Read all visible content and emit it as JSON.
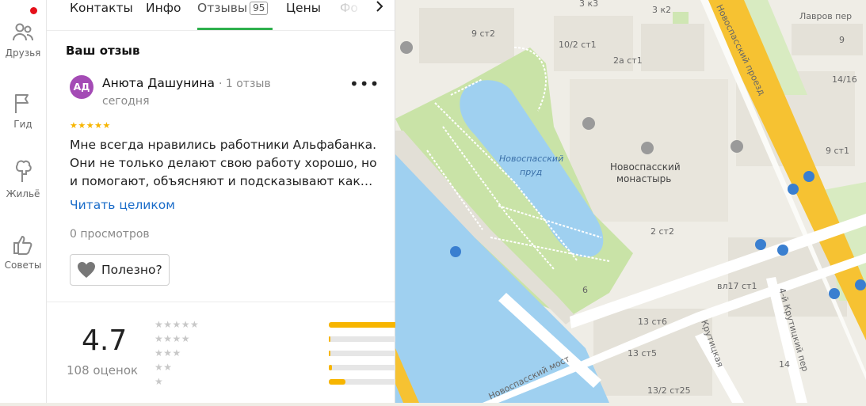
{
  "rail": {
    "items": [
      {
        "label": "Друзья",
        "icon": "friends-icon"
      },
      {
        "label": "Гид",
        "icon": "flag-icon"
      },
      {
        "label": "Жильё",
        "icon": "lodging-icon"
      },
      {
        "label": "Советы",
        "icon": "thumbs-up-icon"
      }
    ]
  },
  "tabs": {
    "contacts": "Контакты",
    "info": "Инфо",
    "reviews": "Отзывы",
    "reviews_count": "95",
    "prices": "Цены",
    "photos": "Фо"
  },
  "review": {
    "section_title": "Ваш отзыв",
    "avatar_initials": "АД",
    "author": "Анюта Дашунина",
    "author_meta": "· 1 отзыв",
    "date": "сегодня",
    "stars": "★★★★★",
    "rating": 5,
    "text_lines": [
      "Мне всегда нравились работники Альфабанка.",
      "Они не только делают свою работу хорошо, но",
      "и помогают, объясняют и подсказывают как…"
    ],
    "read_more": "Читать целиком",
    "views": "0 просмотров",
    "useful": "Полезно?"
  },
  "summary": {
    "rating": "4.7",
    "count": "108 оценок",
    "distribution": [
      {
        "stars": "★★★★★",
        "fraction": 1.0
      },
      {
        "stars": "★★★★",
        "fraction": 0.01
      },
      {
        "stars": "★★★",
        "fraction": 0.01
      },
      {
        "stars": "★★",
        "fraction": 0.02
      },
      {
        "stars": "★",
        "fraction": 0.11
      }
    ]
  },
  "map": {
    "labels": [
      {
        "text": "3 к3"
      },
      {
        "text": "3 к2"
      },
      {
        "text": "Лавров пер"
      },
      {
        "text": "9 ст2"
      },
      {
        "text": "10/2 ст1"
      },
      {
        "text": "2а ст1"
      },
      {
        "text": "14/16"
      },
      {
        "text": "9"
      },
      {
        "text": "9 ст1"
      },
      {
        "text": "Новоспасский проезд"
      },
      {
        "text": "Новоспасский"
      },
      {
        "text": "пруд"
      },
      {
        "text": "Новоспасский"
      },
      {
        "text": "монастырь"
      },
      {
        "text": "2 ст2"
      },
      {
        "text": "вл17 ст1"
      },
      {
        "text": "6"
      },
      {
        "text": "13 ст6"
      },
      {
        "text": "13 ст5"
      },
      {
        "text": "13/2 ст25"
      },
      {
        "text": "14"
      },
      {
        "text": "Крутицкая"
      },
      {
        "text": "4-й Крутицкий пер"
      },
      {
        "text": "Новоспасский мост"
      }
    ]
  }
}
